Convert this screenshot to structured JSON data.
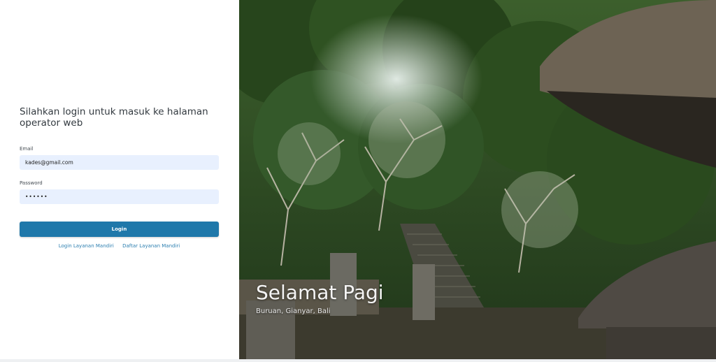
{
  "login": {
    "heading": "Silahkan login untuk masuk ke halaman operator web",
    "email_label": "Email",
    "email_value": "kades@gmail.com",
    "password_label": "Password",
    "password_value": "••••••",
    "login_button": "Login",
    "link_self_service_login": "Login Layanan Mandiri",
    "link_self_service_register": "Daftar Layanan Mandiri"
  },
  "hero": {
    "greeting": "Selamat Pagi",
    "location": "Buruan, Gianyar, Bali",
    "image_description_icon": "bali-temple-photo"
  },
  "colors": {
    "primary_button": "#1f78aa",
    "link": "#2c7fb0",
    "input_background": "#e8f0fe"
  }
}
